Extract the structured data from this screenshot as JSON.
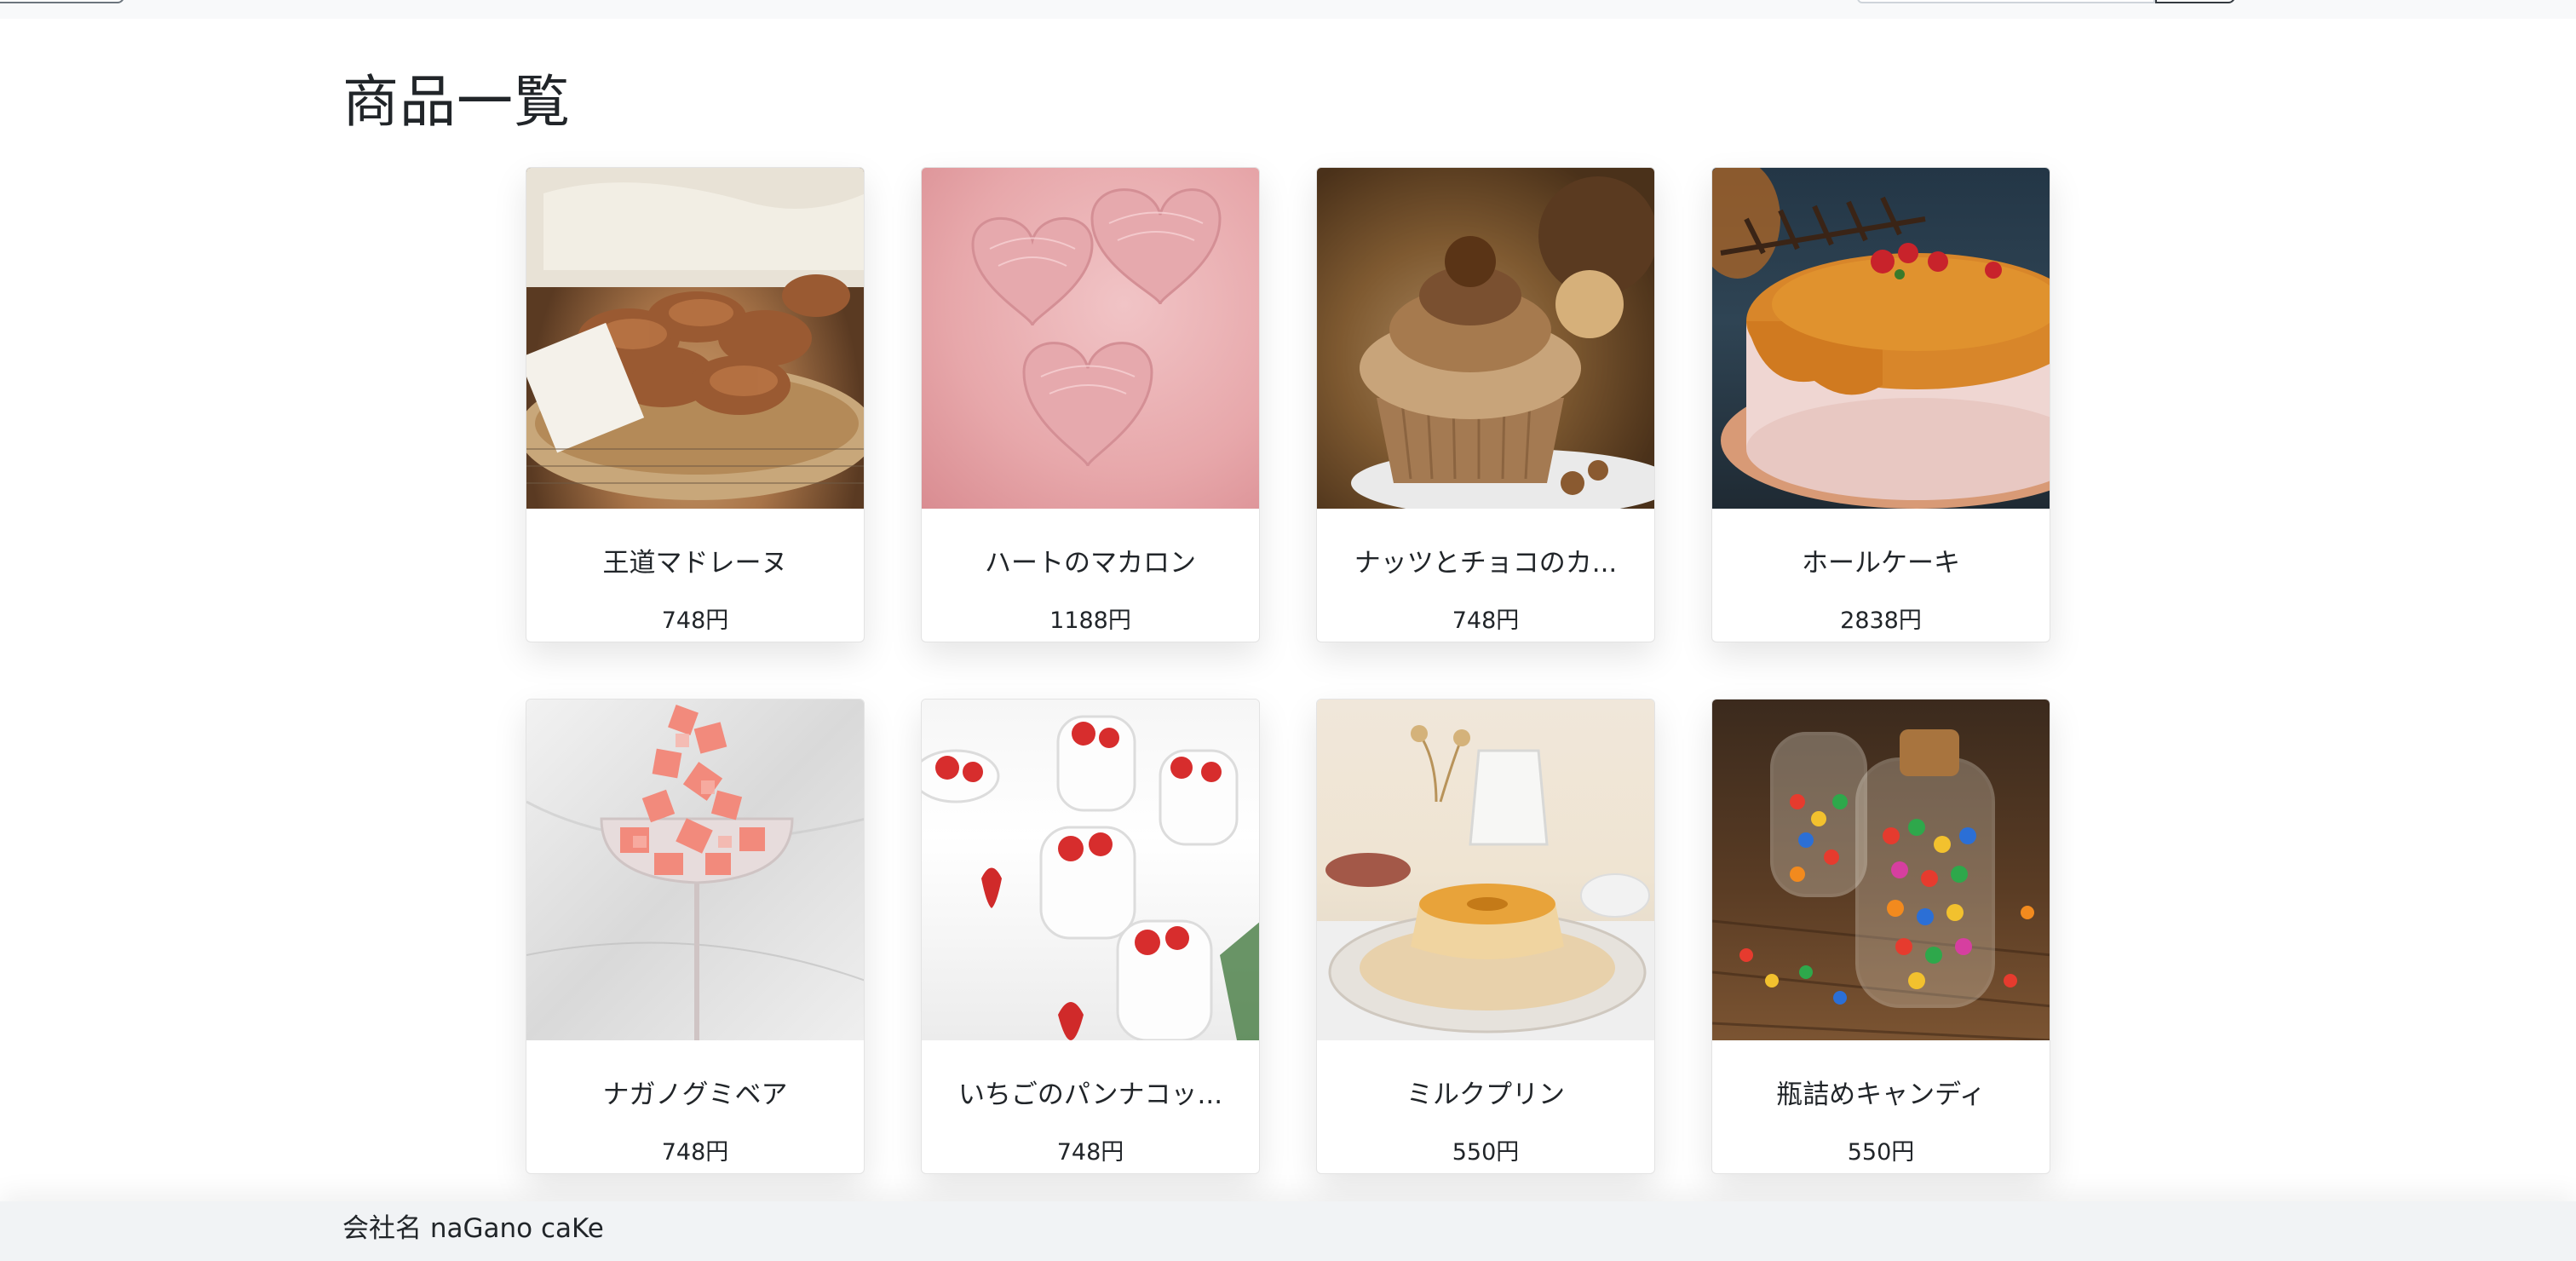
{
  "page": {
    "title": "商品一覧"
  },
  "products": [
    {
      "name": "王道マドレーヌ",
      "price": "748円",
      "image": "madeleine-photo"
    },
    {
      "name": "ハートのマカロン",
      "price": "1188円",
      "image": "heart-macaron-photo"
    },
    {
      "name": "ナッツとチョコのカ...",
      "price": "748円",
      "image": "nut-choco-cupcake-photo"
    },
    {
      "name": "ホールケーキ",
      "price": "2838円",
      "image": "whole-cake-photo"
    },
    {
      "name": "ナガノグミベア",
      "price": "748円",
      "image": "gummy-bear-glass-photo"
    },
    {
      "name": "いちごのパンナコッ...",
      "price": "748円",
      "image": "strawberry-panna-cotta-photo"
    },
    {
      "name": "ミルクプリン",
      "price": "550円",
      "image": "milk-pudding-photo"
    },
    {
      "name": "瓶詰めキャンディ",
      "price": "550円",
      "image": "jar-candy-photo"
    }
  ],
  "footer": {
    "company": "会社名 naGano caKe"
  }
}
